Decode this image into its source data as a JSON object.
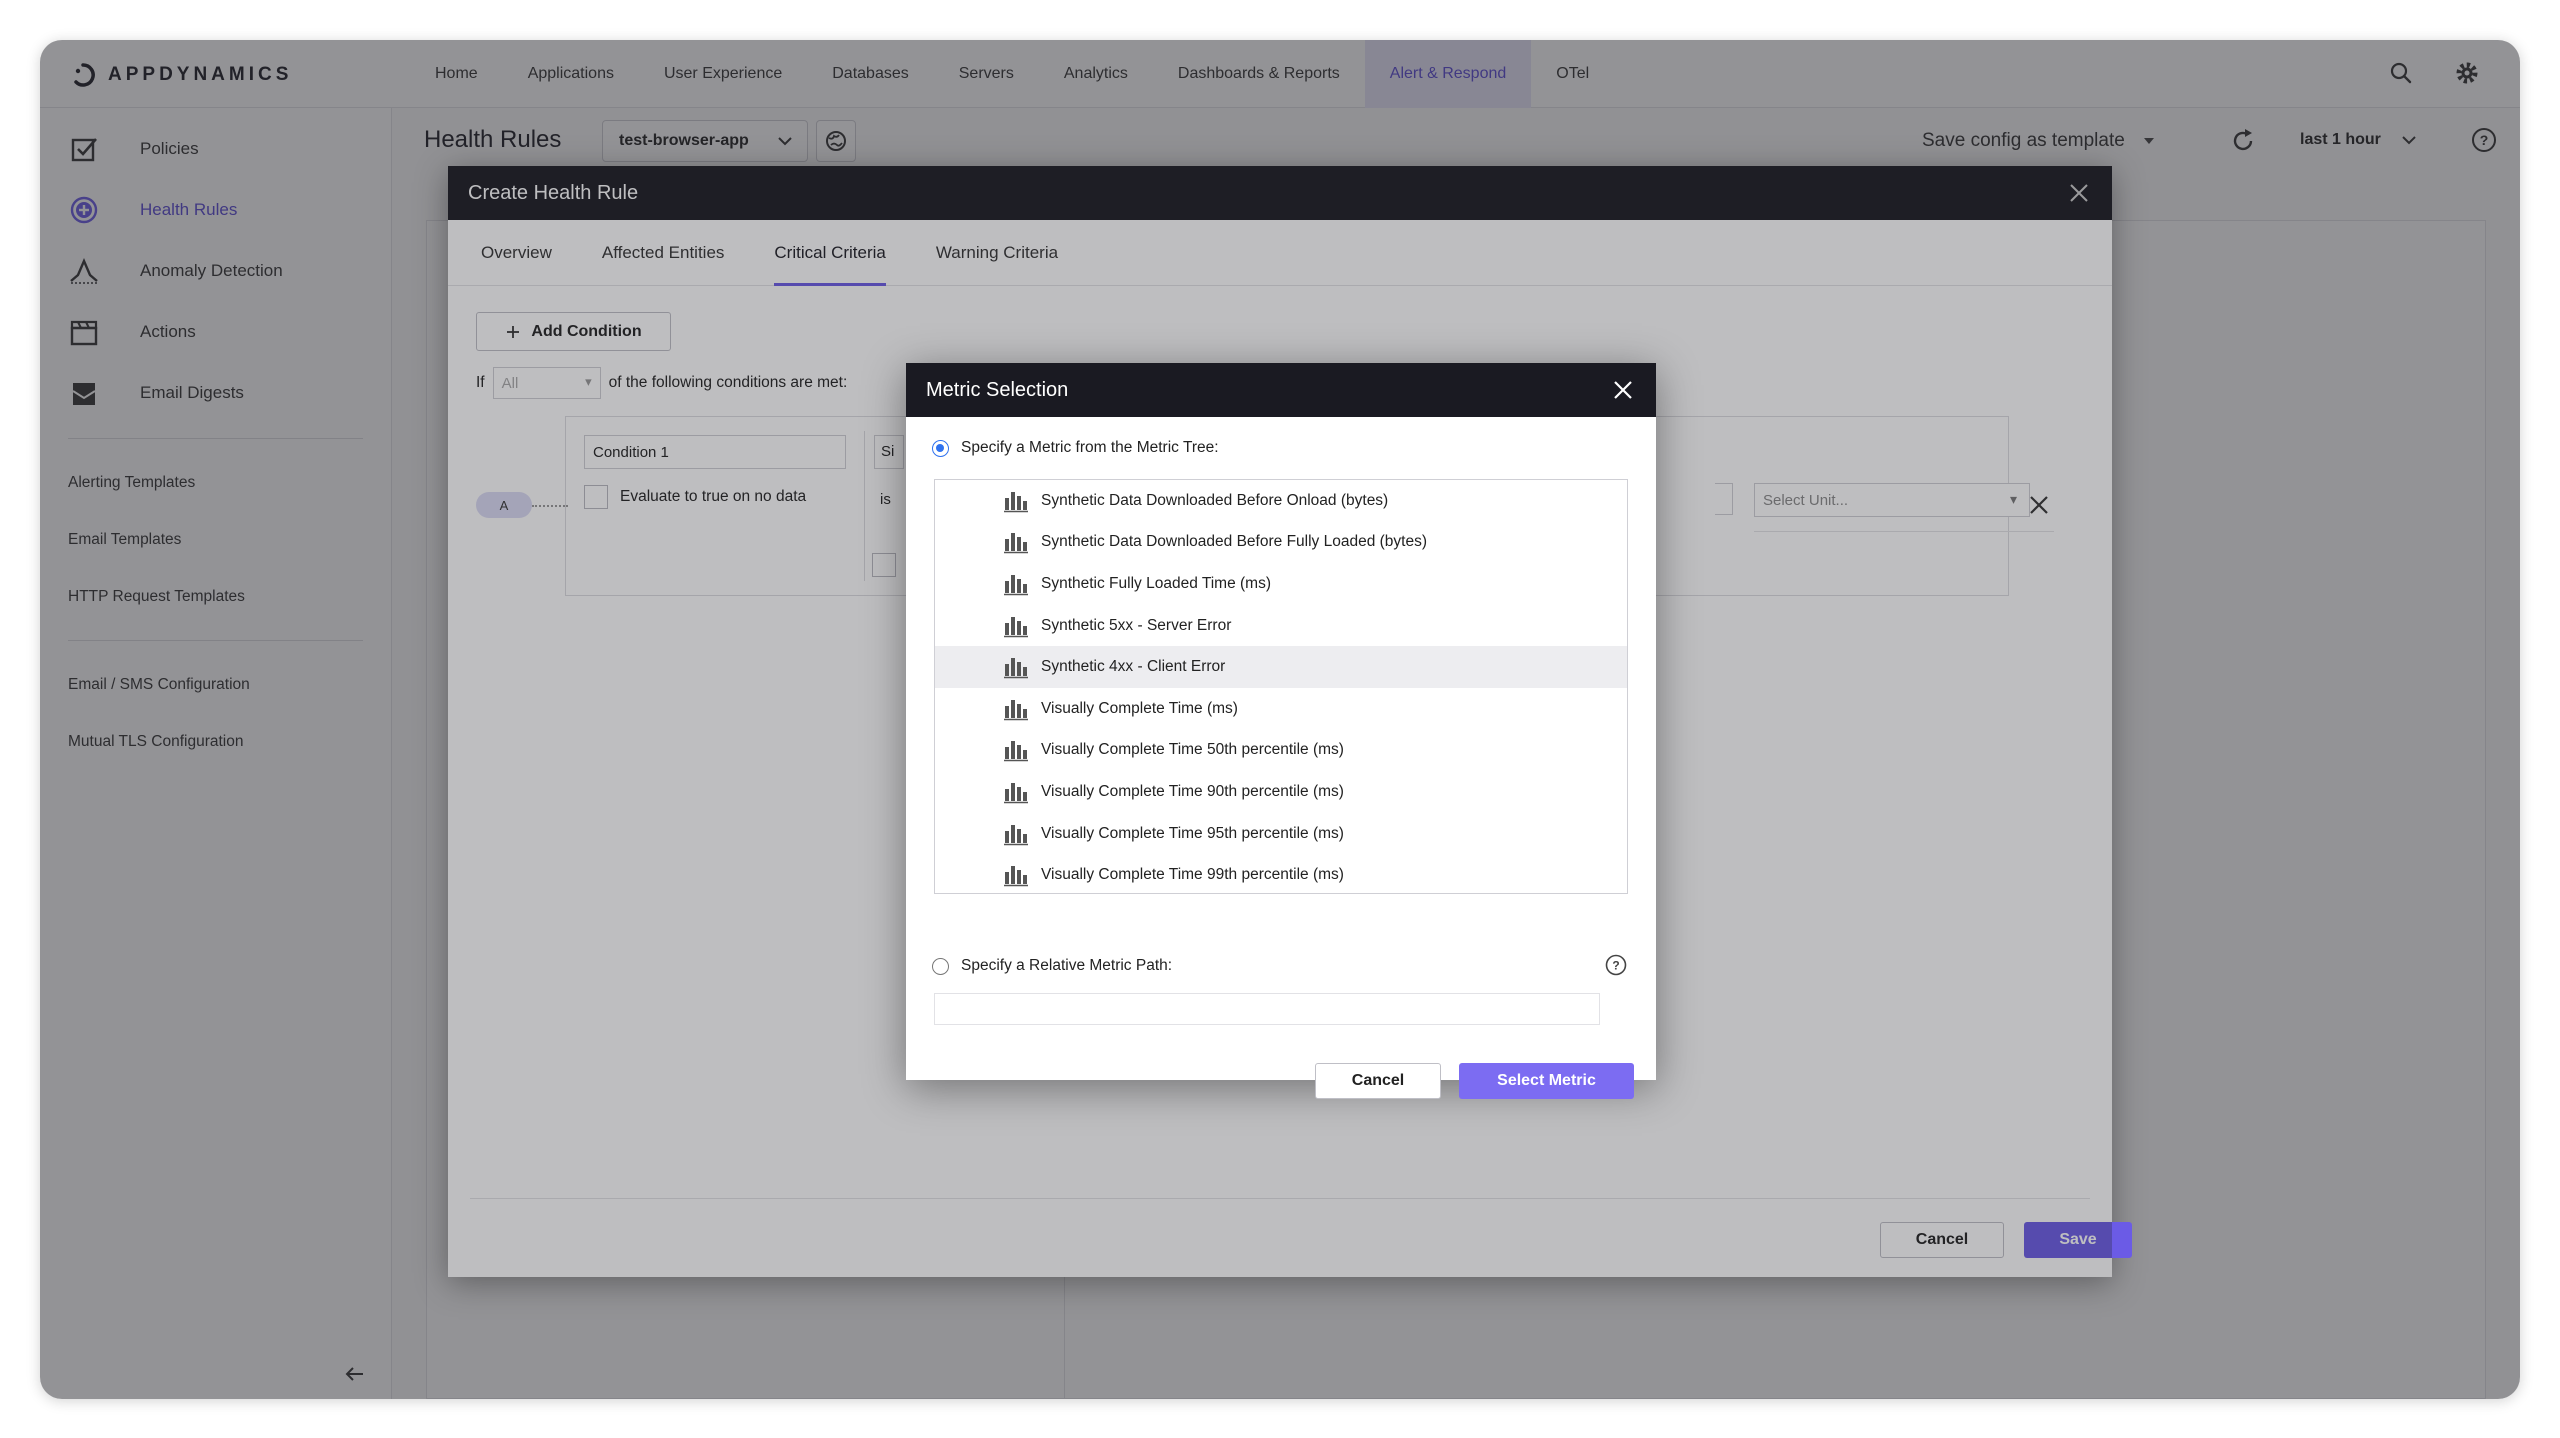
{
  "brand": {
    "name": "APPDYNAMICS"
  },
  "topnav": {
    "items": [
      {
        "label": "Home",
        "active": false
      },
      {
        "label": "Applications",
        "active": false
      },
      {
        "label": "User Experience",
        "active": false
      },
      {
        "label": "Databases",
        "active": false
      },
      {
        "label": "Servers",
        "active": false
      },
      {
        "label": "Analytics",
        "active": false
      },
      {
        "label": "Dashboards & Reports",
        "active": false
      },
      {
        "label": "Alert & Respond",
        "active": true
      },
      {
        "label": "OTel",
        "active": false
      }
    ],
    "icons": [
      "search-icon",
      "gear-icon"
    ]
  },
  "sidebar": {
    "main": [
      {
        "label": "Policies",
        "icon": "checkbox-icon"
      },
      {
        "label": "Health Rules",
        "icon": "plus-circle-icon",
        "active": true
      },
      {
        "label": "Anomaly Detection",
        "icon": "anomaly-icon"
      },
      {
        "label": "Actions",
        "icon": "clapper-icon"
      },
      {
        "label": "Email Digests",
        "icon": "inbox-icon"
      }
    ],
    "templates": [
      "Alerting Templates",
      "Email Templates",
      "HTTP Request Templates"
    ],
    "config": [
      "Email / SMS Configuration",
      "Mutual TLS Configuration"
    ]
  },
  "header": {
    "title": "Health Rules",
    "app_selected": "test-browser-app",
    "save_config": "Save config as template",
    "time_range": "last 1 hour"
  },
  "create_dialog": {
    "title": "Create Health Rule",
    "tabs": [
      "Overview",
      "Affected Entities",
      "Critical Criteria",
      "Warning Criteria"
    ],
    "active_tab": "Critical Criteria",
    "add_condition": "Add Condition",
    "if_label": "If",
    "match_select": "All",
    "conditions_text": "of the following conditions are met:",
    "condition_badge": "A",
    "condition_name": "Condition 1",
    "evaluate_label": "Evaluate to true on no data",
    "si_partial": "Si",
    "is_label": "is",
    "unit_placeholder": "Select Unit...",
    "cancel": "Cancel",
    "save": "Save"
  },
  "metric_dialog": {
    "title": "Metric Selection",
    "option_tree": "Specify a Metric from the Metric Tree:",
    "option_path": "Specify a Relative Metric Path:",
    "metrics": [
      "Synthetic Data Downloaded Before Onload (bytes)",
      "Synthetic Data Downloaded Before Fully Loaded (bytes)",
      "Synthetic Fully Loaded Time (ms)",
      "Synthetic 5xx - Server Error",
      "Synthetic 4xx - Client Error",
      "Visually Complete Time (ms)",
      "Visually Complete Time 50th percentile (ms)",
      "Visually Complete Time 90th percentile (ms)",
      "Visually Complete Time 95th percentile (ms)",
      "Visually Complete Time 99th percentile (ms)"
    ],
    "hovered_index": 4,
    "cancel": "Cancel",
    "select": "Select Metric"
  },
  "colors": {
    "accent": "#6b5be6",
    "header_dark": "#1a1a22",
    "radio": "#2f72ef"
  }
}
